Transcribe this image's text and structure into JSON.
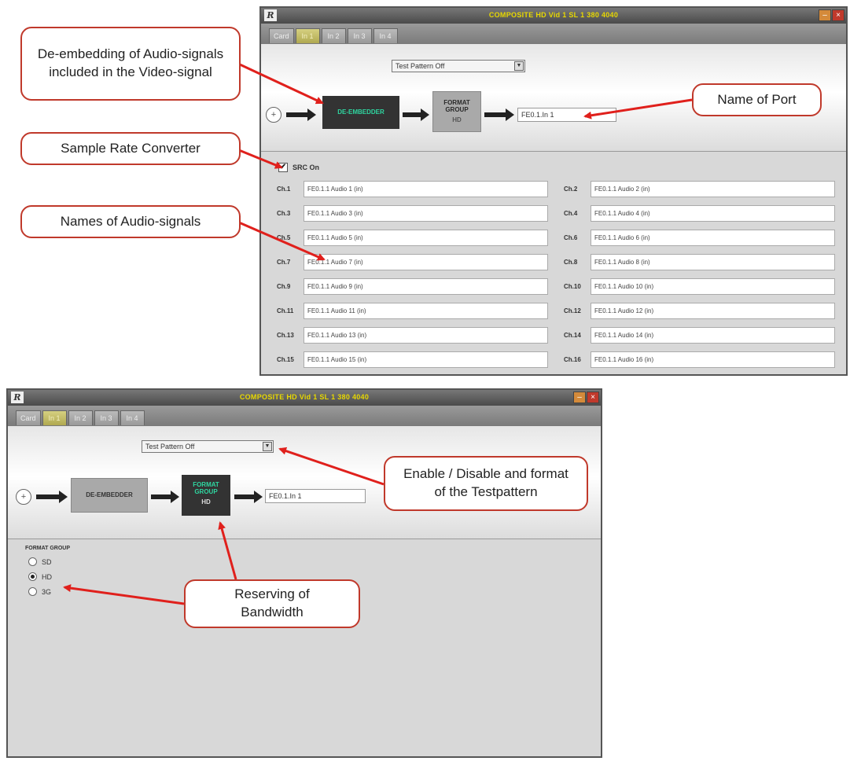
{
  "window1": {
    "title": "COMPOSITE HD Vid 1 SL 1 380 4040",
    "tabs": [
      "Card",
      "In 1",
      "In 2",
      "In 3",
      "In 4"
    ],
    "active_tab": 1,
    "test_pattern": "Test Pattern Off",
    "plus_icon": "+",
    "block_deembed": "DE-EMBEDDER",
    "block_format": "FORMAT GROUP",
    "block_format_sub": "HD",
    "port_name": "FE0.1.In 1",
    "src_label": "SRC On",
    "channels": [
      {
        "label": "Ch.1",
        "value": "FE0.1.1 Audio 1 (in)"
      },
      {
        "label": "Ch.2",
        "value": "FE0.1.1 Audio 2 (in)"
      },
      {
        "label": "Ch.3",
        "value": "FE0.1.1 Audio 3 (in)"
      },
      {
        "label": "Ch.4",
        "value": "FE0.1.1 Audio 4 (in)"
      },
      {
        "label": "Ch.5",
        "value": "FE0.1.1 Audio 5 (in)"
      },
      {
        "label": "Ch.6",
        "value": "FE0.1.1 Audio 6 (in)"
      },
      {
        "label": "Ch.7",
        "value": "FE0.1.1 Audio 7 (in)"
      },
      {
        "label": "Ch.8",
        "value": "FE0.1.1 Audio 8 (in)"
      },
      {
        "label": "Ch.9",
        "value": "FE0.1.1 Audio 9 (in)"
      },
      {
        "label": "Ch.10",
        "value": "FE0.1.1 Audio 10 (in)"
      },
      {
        "label": "Ch.11",
        "value": "FE0.1.1 Audio 11 (in)"
      },
      {
        "label": "Ch.12",
        "value": "FE0.1.1 Audio 12 (in)"
      },
      {
        "label": "Ch.13",
        "value": "FE0.1.1 Audio 13 (in)"
      },
      {
        "label": "Ch.14",
        "value": "FE0.1.1 Audio 14 (in)"
      },
      {
        "label": "Ch.15",
        "value": "FE0.1.1 Audio 15 (in)"
      },
      {
        "label": "Ch.16",
        "value": "FE0.1.1 Audio 16 (in)"
      }
    ]
  },
  "window2": {
    "title": "COMPOSITE HD Vid 1 SL 1 380 4040",
    "tabs": [
      "Card",
      "In 1",
      "In 2",
      "In 3",
      "In 4"
    ],
    "active_tab": 1,
    "test_pattern": "Test Pattern Off",
    "plus_icon": "+",
    "block_deembed": "DE-EMBEDDER",
    "block_format": "FORMAT GROUP",
    "block_format_sub": "HD",
    "port_name": "FE0.1.In 1",
    "format_group_title": "FORMAT GROUP",
    "radios": [
      {
        "label": "SD",
        "selected": false
      },
      {
        "label": "HD",
        "selected": true
      },
      {
        "label": "3G",
        "selected": false
      }
    ]
  },
  "callouts": {
    "deembed": "De-embedding of Audio-signals included in the Video-signal",
    "port": "Name of Port",
    "src": "Sample Rate Converter",
    "names": "Names of Audio-signals",
    "testpattern": "Enable / Disable and format of the Testpattern",
    "bandwidth": "Reserving of Bandwidth"
  },
  "colors": {
    "callout_border": "#c0392b",
    "arrow": "#e0201c",
    "title_text": "#e8d800",
    "block_dark_text": "#2fd6a0"
  },
  "icons": {
    "logo": "R",
    "minimize": "–",
    "close": "×",
    "check": "✔",
    "caret": "▼"
  }
}
